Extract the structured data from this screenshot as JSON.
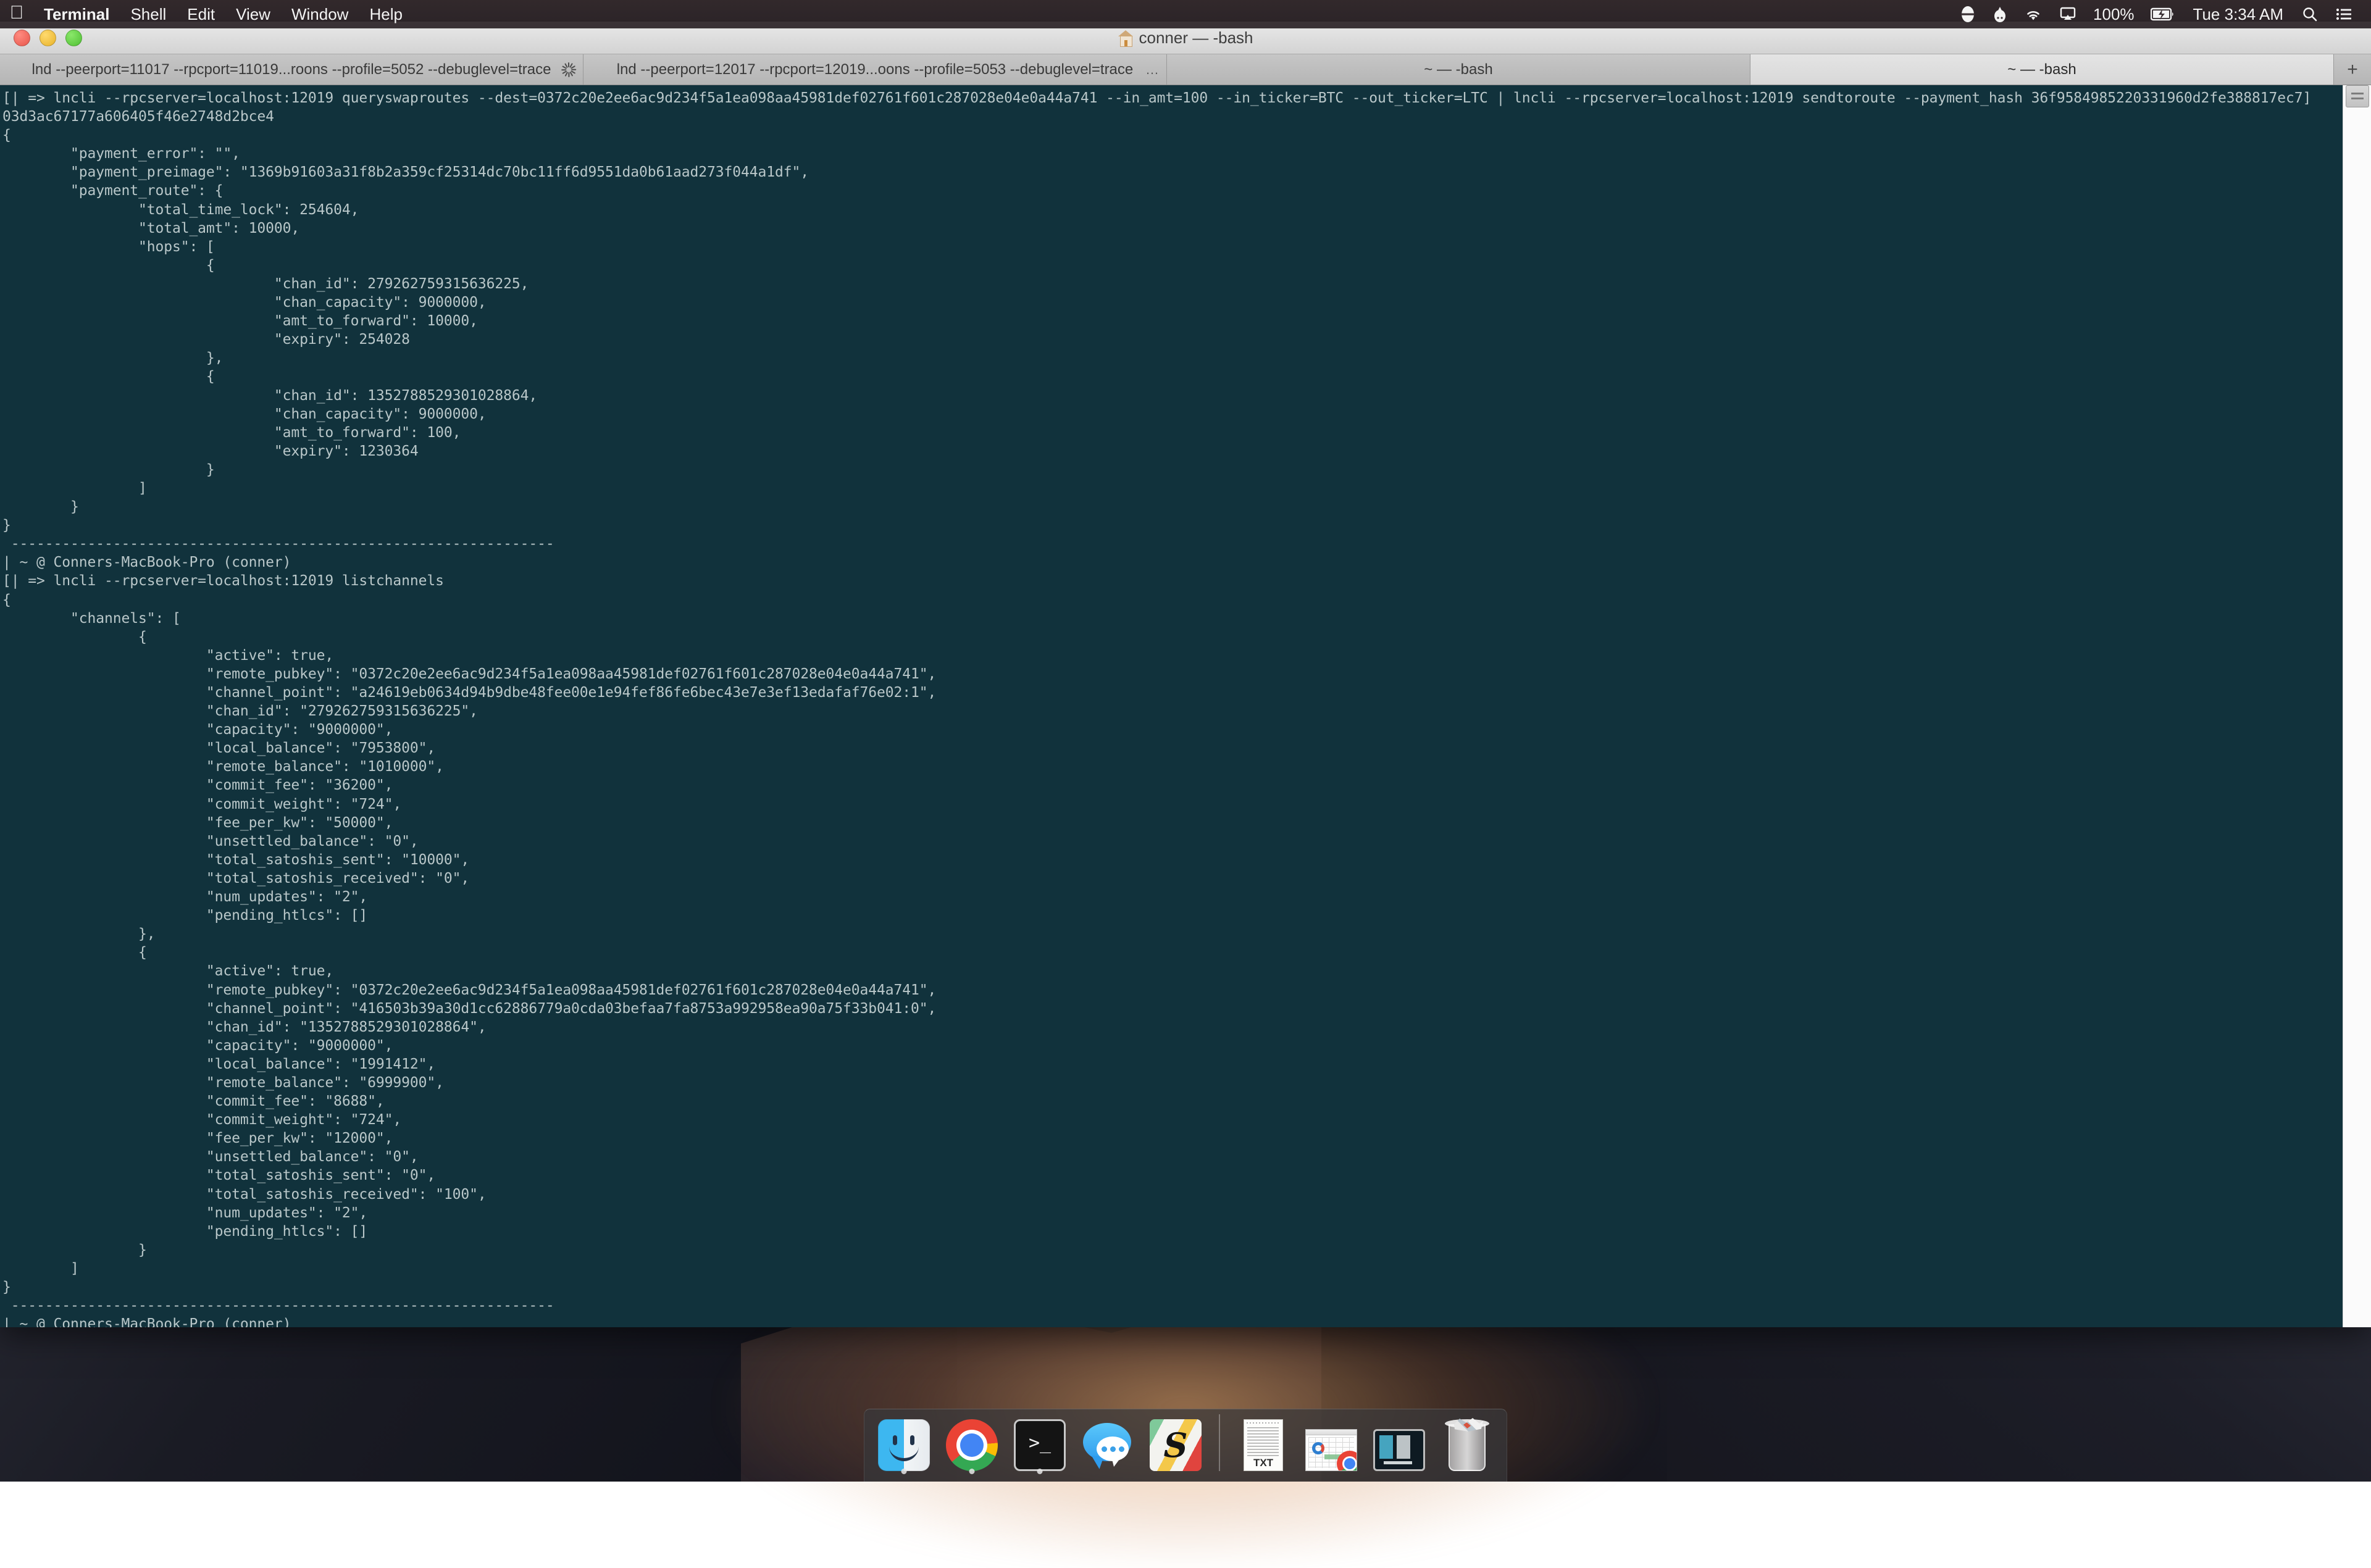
{
  "menubar": {
    "apple_logo": "",
    "items": [
      {
        "label": "Terminal",
        "bold": true
      },
      {
        "label": "Shell"
      },
      {
        "label": "Edit"
      },
      {
        "label": "View"
      },
      {
        "label": "Window"
      },
      {
        "label": "Help"
      }
    ],
    "status": {
      "dropbox_icon": "⬒",
      "bot_icon": "☗",
      "wifi_icon": "◗",
      "airplay_icon": "▭",
      "battery_percent": "100%",
      "battery_icon": "▧",
      "clock": "Tue 3:34 AM",
      "search_icon": "⌕",
      "control_center_icon": "☰"
    }
  },
  "window": {
    "title": "conner — -bash",
    "home_icon": "home-icon",
    "traffic_lights": [
      "close",
      "minimize",
      "zoom"
    ],
    "new_tab_label": "+"
  },
  "tabs": [
    {
      "label": "lnd --peerport=11017 --rpcport=11019...roons --profile=5052 --debuglevel=trace",
      "accessory": "spinner",
      "active": false
    },
    {
      "label": "lnd --peerport=12017 --rpcport=12019...oons --profile=5053 --debuglevel=trace",
      "accessory": "…",
      "active": false
    },
    {
      "label": "~ — -bash",
      "accessory": "",
      "active": false
    },
    {
      "label": "~ — -bash",
      "accessory": "",
      "active": true
    }
  ],
  "terminal": {
    "background_color": "#11323c",
    "foreground_color": "#b9c7c9",
    "lines": [
      "[| => lncli --rpcserver=localhost:12019 queryswaproutes --dest=0372c20e2ee6ac9d234f5a1ea098aa45981def02761f601c287028e04e0a44a741 --in_amt=100 --in_ticker=BTC --out_ticker=LTC | lncli --rpcserver=localhost:12019 sendtoroute --payment_hash 36f9584985220331960d2fe388817ec7]",
      "03d3ac67177a606405f46e2748d2bce4",
      "{",
      "        \"payment_error\": \"\",",
      "        \"payment_preimage\": \"1369b91603a31f8b2a359cf25314dc70bc11ff6d9551da0b61aad273f044a1df\",",
      "        \"payment_route\": {",
      "                \"total_time_lock\": 254604,",
      "                \"total_amt\": 10000,",
      "                \"hops\": [",
      "                        {",
      "                                \"chan_id\": 279262759315636225,",
      "                                \"chan_capacity\": 9000000,",
      "                                \"amt_to_forward\": 10000,",
      "                                \"expiry\": 254028",
      "                        },",
      "                        {",
      "                                \"chan_id\": 1352788529301028864,",
      "                                \"chan_capacity\": 9000000,",
      "                                \"amt_to_forward\": 100,",
      "                                \"expiry\": 1230364",
      "                        }",
      "                ]",
      "        }",
      "}",
      " ----------------------------------------------------------------",
      "| ~ @ Conners-MacBook-Pro (conner)",
      "[| => lncli --rpcserver=localhost:12019 listchannels",
      "{",
      "        \"channels\": [",
      "                {",
      "                        \"active\": true,",
      "                        \"remote_pubkey\": \"0372c20e2ee6ac9d234f5a1ea098aa45981def02761f601c287028e04e0a44a741\",",
      "                        \"channel_point\": \"a24619eb0634d94b9dbe48fee00e1e94fef86fe6bec43e7e3ef13edafaf76e02:1\",",
      "                        \"chan_id\": \"279262759315636225\",",
      "                        \"capacity\": \"9000000\",",
      "                        \"local_balance\": \"7953800\",",
      "                        \"remote_balance\": \"1010000\",",
      "                        \"commit_fee\": \"36200\",",
      "                        \"commit_weight\": \"724\",",
      "                        \"fee_per_kw\": \"50000\",",
      "                        \"unsettled_balance\": \"0\",",
      "                        \"total_satoshis_sent\": \"10000\",",
      "                        \"total_satoshis_received\": \"0\",",
      "                        \"num_updates\": \"2\",",
      "                        \"pending_htlcs\": []",
      "                },",
      "                {",
      "                        \"active\": true,",
      "                        \"remote_pubkey\": \"0372c20e2ee6ac9d234f5a1ea098aa45981def02761f601c287028e04e0a44a741\",",
      "                        \"channel_point\": \"416503b39a30d1cc62886779a0cda03befaa7fa8753a992958ea90a75f33b041:0\",",
      "                        \"chan_id\": \"1352788529301028864\",",
      "                        \"capacity\": \"9000000\",",
      "                        \"local_balance\": \"1991412\",",
      "                        \"remote_balance\": \"6999900\",",
      "                        \"commit_fee\": \"8688\",",
      "                        \"commit_weight\": \"724\",",
      "                        \"fee_per_kw\": \"12000\",",
      "                        \"unsettled_balance\": \"0\",",
      "                        \"total_satoshis_sent\": \"0\",",
      "                        \"total_satoshis_received\": \"100\",",
      "                        \"num_updates\": \"2\",",
      "                        \"pending_htlcs\": []",
      "                }",
      "        ]",
      "}",
      " ----------------------------------------------------------------",
      "| ~ @ Conners-MacBook-Pro (conner)"
    ]
  },
  "dock": {
    "apps": [
      {
        "name": "finder",
        "label": "Finder",
        "running": true
      },
      {
        "name": "chrome",
        "label": "Google Chrome",
        "running": true
      },
      {
        "name": "terminal",
        "label": "Terminal",
        "running": true
      },
      {
        "name": "messages",
        "label": "Messages",
        "running": false
      },
      {
        "name": "sublime",
        "label": "Sublime Text",
        "running": false
      }
    ],
    "minimized": [
      {
        "name": "text-document",
        "label": "TXT"
      },
      {
        "name": "spreadsheet-window",
        "label": ""
      },
      {
        "name": "terminal-window",
        "label": ""
      }
    ],
    "trash": {
      "name": "trash",
      "label": "Trash"
    }
  }
}
